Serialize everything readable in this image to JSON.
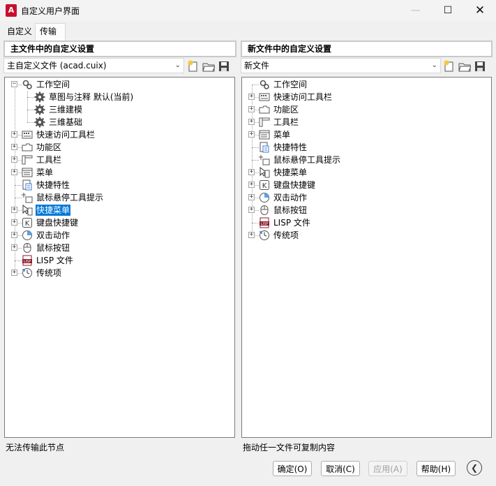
{
  "window": {
    "title": "自定义用户界面",
    "app_icon_letter": "A",
    "minimize_glyph": "—",
    "maximize_glyph": "☐",
    "close_glyph": "✕"
  },
  "tabs": [
    {
      "label": "自定义"
    },
    {
      "label": "传输"
    }
  ],
  "left_panel": {
    "header": "主文件中的自定义设置",
    "file_value": "主自定义文件 (acad.cuix)",
    "status": "无法传输此节点",
    "tree": [
      {
        "label": "工作空间",
        "icon": "workspace-icon"
      },
      {
        "label": "草图与注释 默认(当前)",
        "icon": "gear-icon"
      },
      {
        "label": "三维建模",
        "icon": "gear-icon"
      },
      {
        "label": "三维基础",
        "icon": "gear-icon"
      },
      {
        "label": "快速访问工具栏",
        "icon": "quick-access-toolbar-icon"
      },
      {
        "label": "功能区",
        "icon": "ribbon-icon"
      },
      {
        "label": "工具栏",
        "icon": "toolbar-icon"
      },
      {
        "label": "菜单",
        "icon": "menu-icon"
      },
      {
        "label": "快捷特性",
        "icon": "quick-properties-icon"
      },
      {
        "label": "鼠标悬停工具提示",
        "icon": "rollover-tooltip-icon"
      },
      {
        "label": "快捷菜单",
        "icon": "shortcut-menu-icon"
      },
      {
        "label": "键盘快捷键",
        "icon": "keyboard-shortcut-icon"
      },
      {
        "label": "双击动作",
        "icon": "double-click-icon"
      },
      {
        "label": "鼠标按钮",
        "icon": "mouse-button-icon"
      },
      {
        "label": "LISP 文件",
        "icon": "lisp-file-icon"
      },
      {
        "label": "传统项",
        "icon": "legacy-icon"
      }
    ]
  },
  "right_panel": {
    "header": "新文件中的自定义设置",
    "file_value": "新文件",
    "status": "拖动任一文件可复制内容",
    "tree": [
      {
        "label": "工作空间",
        "icon": "workspace-icon"
      },
      {
        "label": "快速访问工具栏",
        "icon": "quick-access-toolbar-icon"
      },
      {
        "label": "功能区",
        "icon": "ribbon-icon"
      },
      {
        "label": "工具栏",
        "icon": "toolbar-icon"
      },
      {
        "label": "菜单",
        "icon": "menu-icon"
      },
      {
        "label": "快捷特性",
        "icon": "quick-properties-icon"
      },
      {
        "label": "鼠标悬停工具提示",
        "icon": "rollover-tooltip-icon"
      },
      {
        "label": "快捷菜单",
        "icon": "shortcut-menu-icon"
      },
      {
        "label": "键盘快捷键",
        "icon": "keyboard-shortcut-icon"
      },
      {
        "label": "双击动作",
        "icon": "double-click-icon"
      },
      {
        "label": "鼠标按钮",
        "icon": "mouse-button-icon"
      },
      {
        "label": "LISP 文件",
        "icon": "lisp-file-icon"
      },
      {
        "label": "传统项",
        "icon": "legacy-icon"
      }
    ]
  },
  "buttons": {
    "ok": "确定(O)",
    "cancel": "取消(C)",
    "apply": "应用(A)",
    "help": "帮助(H)"
  },
  "colors": {
    "selection": "#0078d7",
    "app_icon": "#c8102e"
  }
}
